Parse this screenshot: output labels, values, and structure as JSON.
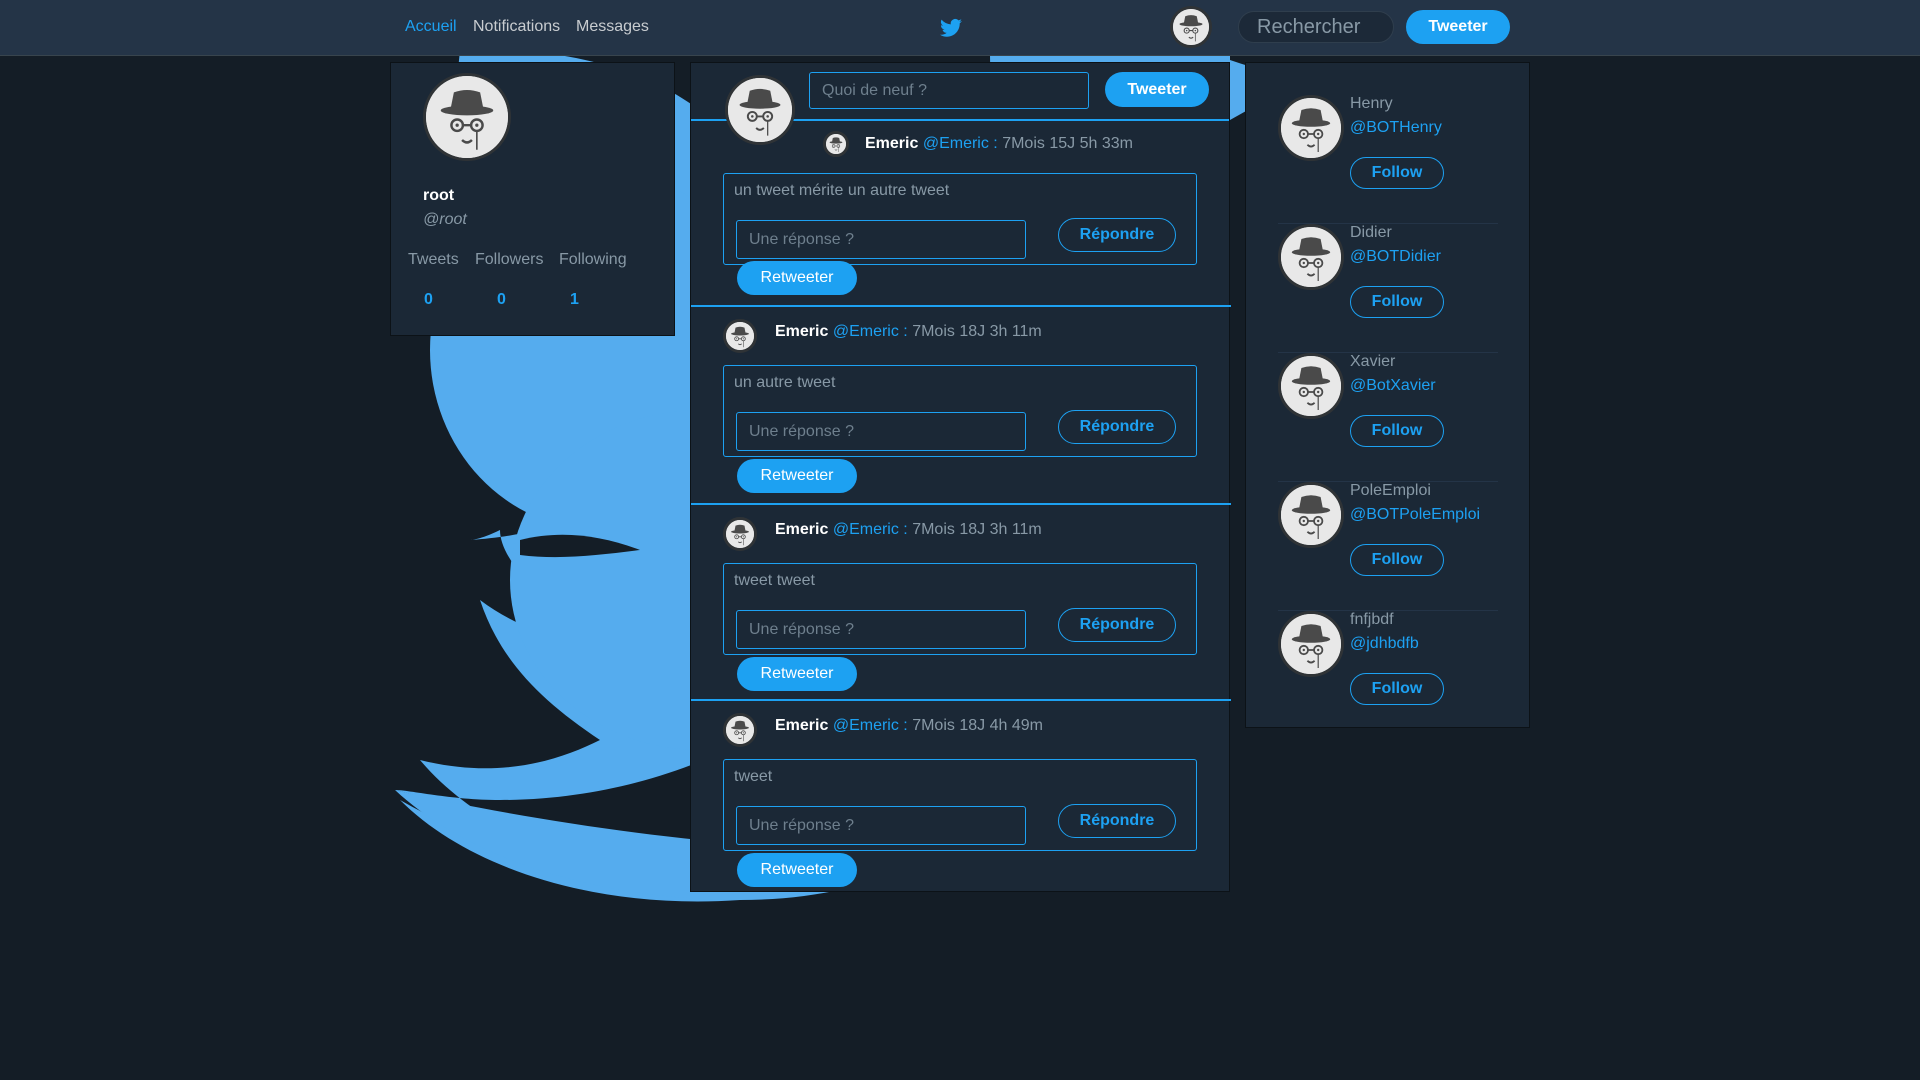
{
  "nav": {
    "home": "Accueil",
    "notifications": "Notifications",
    "messages": "Messages",
    "search_placeholder": "Rechercher",
    "tweet_button": "Tweeter"
  },
  "profile": {
    "name": "root",
    "handle": "@root",
    "stats": [
      {
        "label": "Tweets",
        "value": "0"
      },
      {
        "label": "Followers",
        "value": "0"
      },
      {
        "label": "Following",
        "value": "1"
      }
    ]
  },
  "composer": {
    "placeholder": "Quoi de neuf ?",
    "button": "Tweeter"
  },
  "tweets": [
    {
      "name": "Emeric",
      "handle": "@Emeric :",
      "time": "7Mois 15J 5h 33m",
      "text": "un tweet mérite un autre tweet",
      "reply_placeholder": "Une réponse ?",
      "reply_button": "Répondre",
      "retweet_button": "Retweeter"
    },
    {
      "name": "Emeric",
      "handle": "@Emeric :",
      "time": "7Mois 18J 3h 11m",
      "text": "un autre tweet",
      "reply_placeholder": "Une réponse ?",
      "reply_button": "Répondre",
      "retweet_button": "Retweeter"
    },
    {
      "name": "Emeric",
      "handle": "@Emeric :",
      "time": "7Mois 18J 3h 11m",
      "text": "tweet tweet",
      "reply_placeholder": "Une réponse ?",
      "reply_button": "Répondre",
      "retweet_button": "Retweeter"
    },
    {
      "name": "Emeric",
      "handle": "@Emeric :",
      "time": "7Mois 18J 4h 49m",
      "text": "tweet",
      "reply_placeholder": "Une réponse ?",
      "reply_button": "Répondre",
      "retweet_button": "Retweeter"
    }
  ],
  "suggestions": [
    {
      "name": "Henry",
      "handle": "@BOTHenry",
      "button": "Follow"
    },
    {
      "name": "Didier",
      "handle": "@BOTDidier",
      "button": "Follow"
    },
    {
      "name": "Xavier",
      "handle": "@BotXavier",
      "button": "Follow"
    },
    {
      "name": "PoleEmploi",
      "handle": "@BOTPoleEmploi",
      "button": "Follow"
    },
    {
      "name": "fnfjbdf",
      "handle": "@jdhbdfb",
      "button": "Follow"
    }
  ],
  "colors": {
    "accent": "#1da1f2",
    "background": "#141d26",
    "panel": "#1b2836",
    "topbar": "#243447"
  },
  "icons": {
    "logo": "twitter-bird-icon",
    "avatar": "incognito-avatar"
  }
}
